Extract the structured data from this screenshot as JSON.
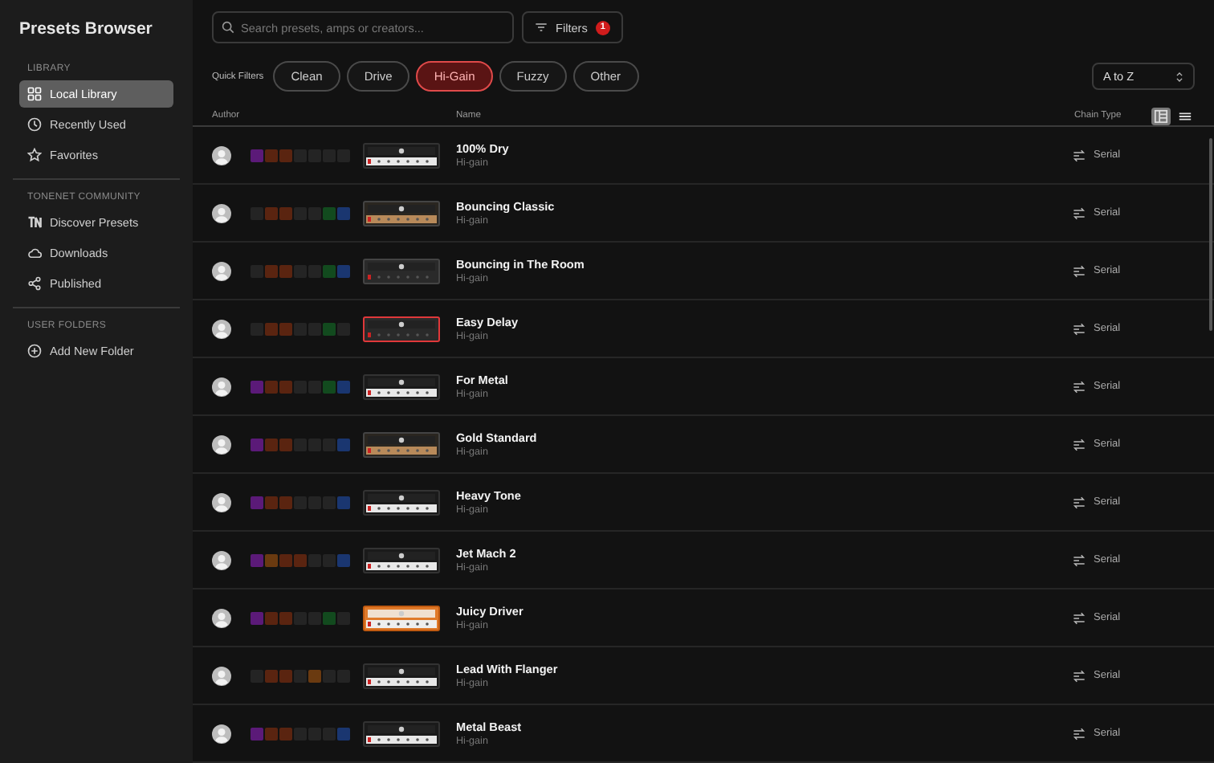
{
  "sidebar": {
    "title": "Presets Browser",
    "sections": [
      {
        "heading": "LIBRARY",
        "items": [
          {
            "label": "Local Library",
            "selected": true
          },
          {
            "label": "Recently Used",
            "selected": false
          },
          {
            "label": "Favorites",
            "selected": false
          }
        ]
      },
      {
        "heading": "TONENET COMMUNITY",
        "items": [
          {
            "label": "Discover Presets",
            "selected": false
          },
          {
            "label": "Downloads",
            "selected": false
          },
          {
            "label": "Published",
            "selected": false
          }
        ]
      },
      {
        "heading": "USER FOLDERS",
        "items": [
          {
            "label": "Add New Folder",
            "selected": false
          }
        ]
      }
    ]
  },
  "search": {
    "placeholder": "Search presets, amps or creators..."
  },
  "filters_button": {
    "label": "Filters",
    "badge": "1"
  },
  "quick_filters": {
    "label": "Quick Filters",
    "chips": [
      {
        "label": "Clean",
        "selected": false
      },
      {
        "label": "Drive",
        "selected": false
      },
      {
        "label": "Hi-Gain",
        "selected": true
      },
      {
        "label": "Fuzzy",
        "selected": false
      },
      {
        "label": "Other",
        "selected": false
      }
    ]
  },
  "sort": {
    "value": "A to Z"
  },
  "view_toggle": [
    {
      "kind": "detail",
      "selected": true
    },
    {
      "kind": "list",
      "selected": false
    }
  ],
  "table": {
    "columns": [
      "Author",
      "Name",
      "Chain Type"
    ],
    "rows": [
      {
        "name": "100% Dry",
        "category": "Hi-gain",
        "chain": "Serial",
        "slots": [
          {
            "kind": "pre"
          },
          {
            "kind": "amp"
          },
          {
            "kind": "cab"
          },
          {
            "kind": "empty"
          },
          {
            "kind": "empty"
          },
          {
            "kind": "empty"
          },
          {
            "kind": "empty"
          }
        ]
      },
      {
        "name": "Bouncing Classic",
        "category": "Hi-gain",
        "chain": "Serial",
        "slots": [
          {
            "kind": "empty"
          },
          {
            "kind": "amp"
          },
          {
            "kind": "cab"
          },
          {
            "kind": "empty"
          },
          {
            "kind": "empty"
          },
          {
            "kind": "dly"
          },
          {
            "kind": "rev"
          }
        ]
      },
      {
        "name": "Bouncing in The Room",
        "category": "Hi-gain",
        "chain": "Serial",
        "slots": [
          {
            "kind": "empty"
          },
          {
            "kind": "amp"
          },
          {
            "kind": "cab"
          },
          {
            "kind": "empty"
          },
          {
            "kind": "empty"
          },
          {
            "kind": "dly"
          },
          {
            "kind": "rev"
          }
        ]
      },
      {
        "name": "Easy Delay",
        "category": "Hi-gain",
        "chain": "Serial",
        "slots": [
          {
            "kind": "empty"
          },
          {
            "kind": "amp"
          },
          {
            "kind": "cab"
          },
          {
            "kind": "empty"
          },
          {
            "kind": "empty"
          },
          {
            "kind": "dly"
          },
          {
            "kind": "empty"
          }
        ]
      },
      {
        "name": "For Metal",
        "category": "Hi-gain",
        "chain": "Serial",
        "slots": [
          {
            "kind": "pre"
          },
          {
            "kind": "amp"
          },
          {
            "kind": "cab"
          },
          {
            "kind": "empty"
          },
          {
            "kind": "empty"
          },
          {
            "kind": "dly"
          },
          {
            "kind": "rev"
          }
        ]
      },
      {
        "name": "Gold Standard",
        "category": "Hi-gain",
        "chain": "Serial",
        "slots": [
          {
            "kind": "pre"
          },
          {
            "kind": "amp"
          },
          {
            "kind": "cab"
          },
          {
            "kind": "empty"
          },
          {
            "kind": "empty"
          },
          {
            "kind": "empty"
          },
          {
            "kind": "rev"
          }
        ]
      },
      {
        "name": "Heavy Tone",
        "category": "Hi-gain",
        "chain": "Serial",
        "slots": [
          {
            "kind": "pre"
          },
          {
            "kind": "amp"
          },
          {
            "kind": "cab"
          },
          {
            "kind": "empty"
          },
          {
            "kind": "empty"
          },
          {
            "kind": "empty"
          },
          {
            "kind": "rev"
          }
        ]
      },
      {
        "name": "Jet Mach 2",
        "category": "Hi-gain",
        "chain": "Serial",
        "slots": [
          {
            "kind": "pre"
          },
          {
            "kind": "mod"
          },
          {
            "kind": "amp"
          },
          {
            "kind": "cab"
          },
          {
            "kind": "empty"
          },
          {
            "kind": "empty"
          },
          {
            "kind": "rev"
          }
        ]
      },
      {
        "name": "Juicy Driver",
        "category": "Hi-gain",
        "chain": "Serial",
        "slots": [
          {
            "kind": "pre"
          },
          {
            "kind": "amp"
          },
          {
            "kind": "cab"
          },
          {
            "kind": "empty"
          },
          {
            "kind": "empty"
          },
          {
            "kind": "dly"
          },
          {
            "kind": "empty"
          }
        ]
      },
      {
        "name": "Lead With Flanger",
        "category": "Hi-gain",
        "chain": "Serial",
        "slots": [
          {
            "kind": "empty"
          },
          {
            "kind": "amp"
          },
          {
            "kind": "cab"
          },
          {
            "kind": "empty"
          },
          {
            "kind": "mod"
          },
          {
            "kind": "empty"
          },
          {
            "kind": "empty"
          }
        ]
      },
      {
        "name": "Metal Beast",
        "category": "Hi-gain",
        "chain": "Serial",
        "slots": [
          {
            "kind": "pre"
          },
          {
            "kind": "amp"
          },
          {
            "kind": "cab"
          },
          {
            "kind": "empty"
          },
          {
            "kind": "empty"
          },
          {
            "kind": "empty"
          },
          {
            "kind": "rev"
          }
        ]
      }
    ]
  }
}
